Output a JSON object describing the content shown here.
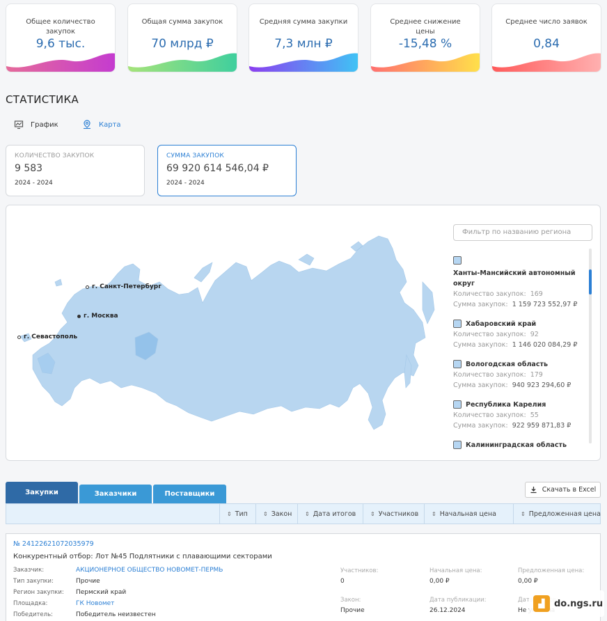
{
  "kpis": [
    {
      "label": "Общее количество закупок",
      "value": "9,6 тыс."
    },
    {
      "label": "Общая сумма закупок",
      "value": "70 млрд ₽"
    },
    {
      "label": "Средняя сумма закупки",
      "value": "7,3 млн ₽"
    },
    {
      "label": "Среднее снижение цены",
      "value": "-15,48 %"
    },
    {
      "label": "Среднее число заявок",
      "value": "0,84"
    }
  ],
  "colors": {
    "accent": "#2b7fd4",
    "tab_active": "#2f6aa6",
    "tab_inactive": "#3a99d6",
    "map_fill": "#b8d6f0",
    "map_highlight": "#94c2ea",
    "wave1": [
      "#e56a9a",
      "#c43bd0"
    ],
    "wave2": [
      "#a6e37a",
      "#3ecf9e"
    ],
    "wave3": [
      "#8b3ef0",
      "#3fc4f5"
    ],
    "wave4": [
      "#ff6f6f",
      "#ffe14a"
    ],
    "wave5": [
      "#ff5a5a",
      "#ffb1b1"
    ]
  },
  "section_title": "СТАТИСТИКА",
  "view_tabs": {
    "chart": "График",
    "map": "Карта"
  },
  "stat_cards": [
    {
      "title": "КОЛИЧЕСТВО ЗАКУПОК",
      "value": "9 583",
      "period": "2024 - 2024"
    },
    {
      "title": "СУММА ЗАКУПОК",
      "value": "69 920 614 546,04 ₽",
      "period": "2024 - 2024"
    }
  ],
  "map": {
    "cities": [
      "г. Санкт-Петербург",
      "г. Москва",
      "г. Севастополь"
    ],
    "filter_placeholder": "Фильтр по названию региона",
    "count_label": "Количество закупок:",
    "sum_label": "Сумма закупок:",
    "regions": [
      {
        "name": "Ханты-Мансийский автономный округ",
        "count": "169",
        "sum": "1 159 723 552,97 ₽"
      },
      {
        "name": "Хабаровский край",
        "count": "92",
        "sum": "1 146 020 084,29 ₽"
      },
      {
        "name": "Вологодская область",
        "count": "179",
        "sum": "940 923 294,60 ₽"
      },
      {
        "name": "Республика Карелия",
        "count": "55",
        "sum": "922 959 871,83 ₽"
      },
      {
        "name": "Калининградская область",
        "count": "",
        "sum": ""
      }
    ]
  },
  "list_tabs": [
    "Закупки",
    "Заказчики",
    "Поставщики"
  ],
  "excel_button": "Скачать в Excel",
  "columns": [
    "Тип",
    "Закон",
    "Дата итогов",
    "Участников",
    "Начальная цена",
    "Предложенная цена"
  ],
  "purchase": {
    "number": "№ 24122621072035979",
    "title": "Конкурентный отбор: Лот №45 Подлятники с плавающими секторами",
    "fields": [
      {
        "k": "Заказчик:",
        "v": "АКЦИОНЕРНОЕ ОБЩЕСТВО НОВОМЕТ-ПЕРМЬ",
        "link": true
      },
      {
        "k": "Тип закупки:",
        "v": "Прочие",
        "link": false
      },
      {
        "k": "Регион закупки:",
        "v": "Пермский край",
        "link": false
      },
      {
        "k": "Площадка:",
        "v": "ГК Новомет",
        "link": true
      },
      {
        "k": "Победитель:",
        "v": "Победитель неизвестен",
        "link": false
      }
    ],
    "participants_label": "Участников:",
    "participants": "0",
    "start_price_label": "Начальная цена:",
    "start_price": "0,00 ₽",
    "offered_price_label": "Предложенная цена:",
    "offered_price": "0,00 ₽",
    "law_label": "Закон:",
    "law": "Прочие",
    "pub_date_label": "Дата публикации:",
    "pub_date": "26.12.2024",
    "results_date_label": "Дата итогов:",
    "results_date": "Не указана"
  },
  "watermark": "do.ngs.ru"
}
